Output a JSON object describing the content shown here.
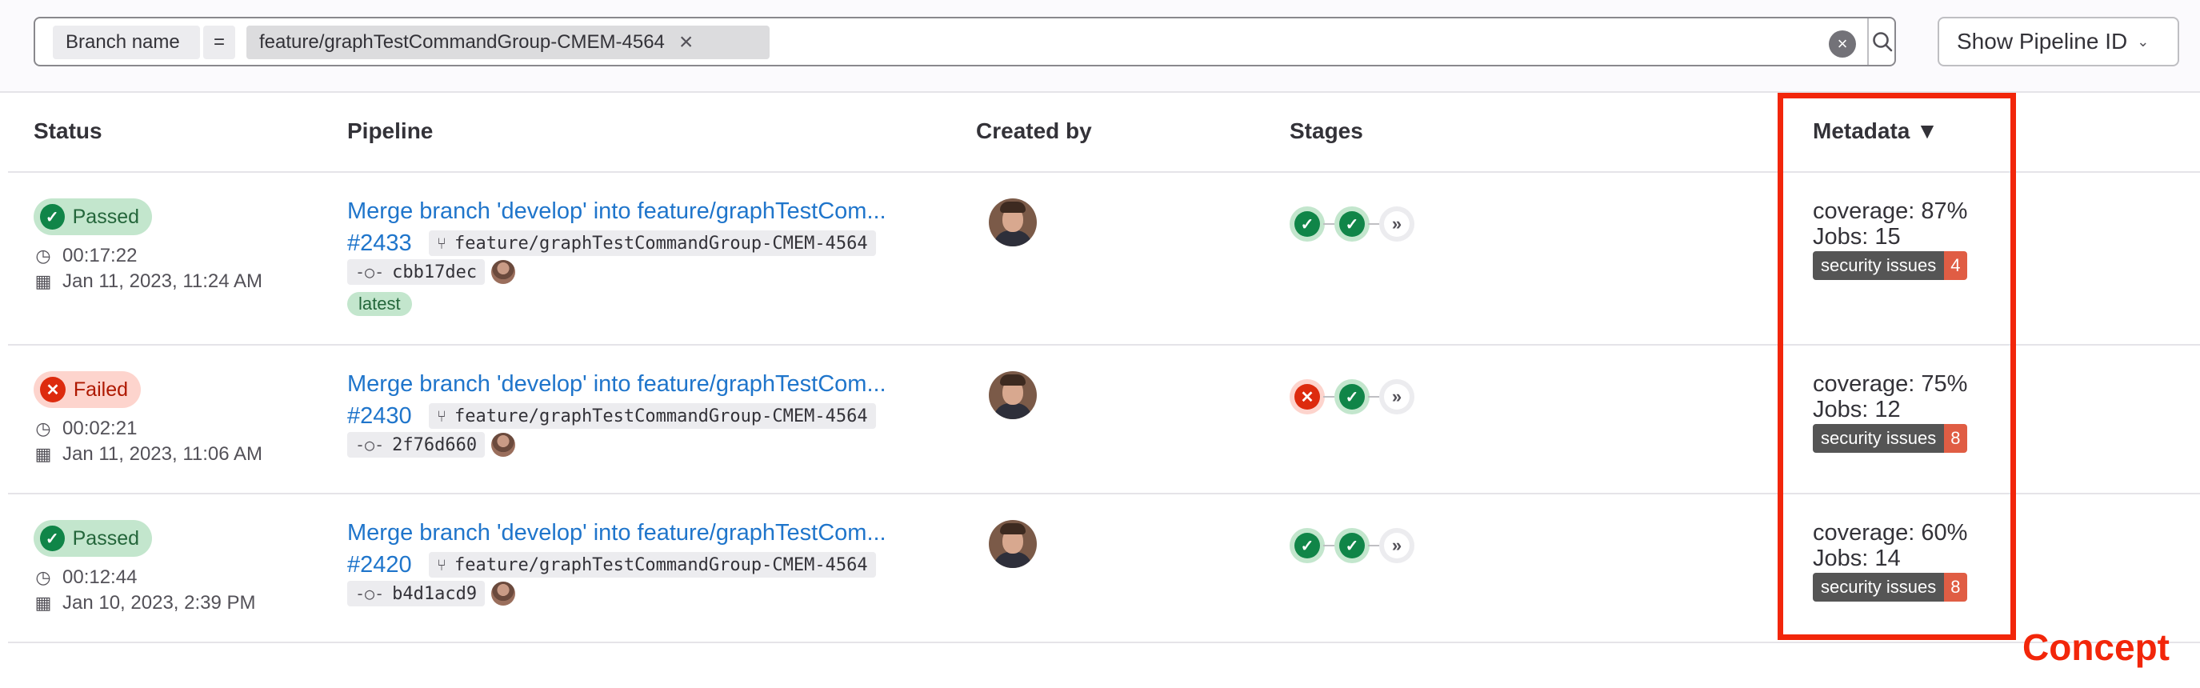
{
  "filter": {
    "token_name": "Branch name",
    "token_operator": "=",
    "token_value": "feature/graphTestCommandGroup-CMEM-4564",
    "token_remove_icon": "close-icon",
    "clear_icon": "clear-icon",
    "search_icon": "search-icon",
    "pipeline_id_button": "Show Pipeline ID",
    "dropdown_icon": "chevron-down-icon"
  },
  "columns": {
    "status": "Status",
    "pipeline": "Pipeline",
    "created_by": "Created by",
    "stages": "Stages",
    "metadata": "Metadata ▼"
  },
  "rows": [
    {
      "status": "Passed",
      "status_icon": "check-circle-icon",
      "duration": "00:17:22",
      "date": "Jan 11, 2023, 11:24 AM",
      "title": "Merge branch 'develop' into feature/graphTestCom...",
      "id": "#2433",
      "branch": "feature/graphTestCommandGroup-CMEM-4564",
      "commit": "cbb17dec",
      "tag": "latest",
      "stages": [
        "success",
        "success",
        "more"
      ],
      "coverage": "coverage: 87%",
      "jobs": "Jobs: 15",
      "security_label": "security issues",
      "security_count": "4"
    },
    {
      "status": "Failed",
      "status_icon": "x-circle-icon",
      "duration": "00:02:21",
      "date": "Jan 11, 2023, 11:06 AM",
      "title": "Merge branch 'develop' into feature/graphTestCom...",
      "id": "#2430",
      "branch": "feature/graphTestCommandGroup-CMEM-4564",
      "commit": "2f76d660",
      "stages": [
        "failed",
        "success",
        "more"
      ],
      "coverage": "coverage: 75%",
      "jobs": "Jobs: 12",
      "security_label": "security issues",
      "security_count": "8"
    },
    {
      "status": "Passed",
      "status_icon": "check-circle-icon",
      "duration": "00:12:44",
      "date": "Jan 10, 2023, 2:39 PM",
      "title": "Merge branch 'develop' into feature/graphTestCom...",
      "id": "#2420",
      "branch": "feature/graphTestCommandGroup-CMEM-4564",
      "commit": "b4d1acd9",
      "stages": [
        "success",
        "success",
        "more"
      ],
      "coverage": "coverage: 60%",
      "jobs": "Jobs: 14",
      "security_label": "security issues",
      "security_count": "8"
    }
  ],
  "annotation": {
    "label": "Concept",
    "color": "#f2260a"
  },
  "colors": {
    "link": "#1f75cb",
    "success": "#108548",
    "danger": "#dd2b0e",
    "badge_red": "#e05d44"
  }
}
